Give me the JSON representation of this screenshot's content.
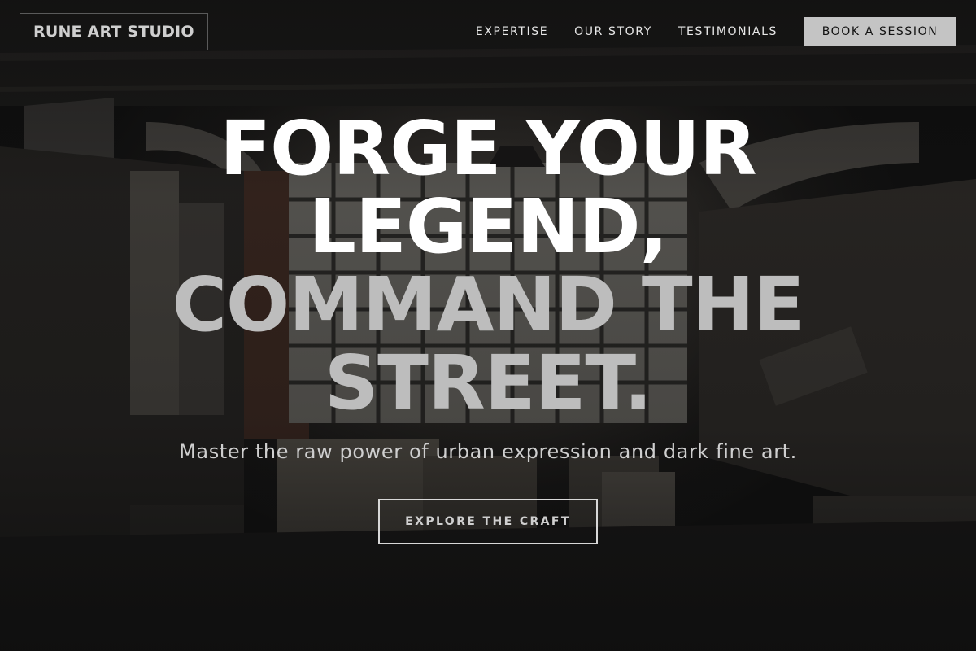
{
  "nav": {
    "brand": "RUNE ART STUDIO",
    "links": [
      "EXPERTISE",
      "OUR STORY",
      "TESTIMONIALS"
    ],
    "cta_label": "BOOK A SESSION"
  },
  "hero": {
    "headline_line1": "FORGE YOUR",
    "headline_line2": "LEGEND,",
    "headline_line3": "COMMAND THE",
    "headline_line4": "STREET.",
    "subheadline": "Master the raw power of urban expression and dark fine art.",
    "cta_label": "EXPLORE THE CRAFT"
  },
  "colors": {
    "background": "#121212",
    "headline_primary": "#ffffff",
    "headline_secondary": "#bdbdbd",
    "nav_cta_bg": "#c4c4c4"
  }
}
